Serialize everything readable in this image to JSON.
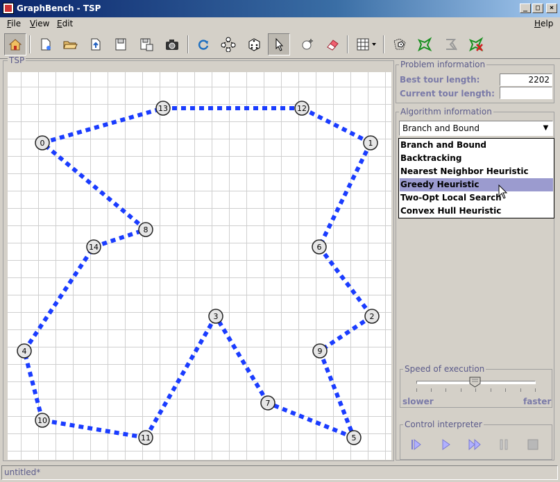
{
  "window": {
    "title": "GraphBench - TSP",
    "btn_min": "_",
    "btn_max": "□",
    "btn_close": "×"
  },
  "menu": {
    "file": {
      "mn": "F",
      "rest": "ile"
    },
    "view": {
      "mn": "V",
      "rest": "iew"
    },
    "edit": {
      "mn": "E",
      "rest": "dit"
    },
    "help": {
      "mn": "H",
      "rest": "elp"
    }
  },
  "toolbar": {
    "icons": [
      "home-icon",
      "new-graph-icon",
      "open-folder-icon",
      "import-icon",
      "save-icon",
      "save-as-icon",
      "camera-icon",
      "refresh-icon",
      "layout-icon",
      "random-dice-icon",
      "select-pointer-icon",
      "add-node-icon",
      "eraser-icon",
      "grid-icon",
      "random-graph-icon",
      "tour-icon",
      "clear-tour-icon",
      "delete-tour-icon"
    ],
    "pressed": "select-pointer-icon"
  },
  "tsp_panel": {
    "title": "TSP"
  },
  "graph": {
    "nodes": [
      {
        "id": "0"
      },
      {
        "id": "1"
      },
      {
        "id": "2"
      },
      {
        "id": "3"
      },
      {
        "id": "4"
      },
      {
        "id": "5"
      },
      {
        "id": "6"
      },
      {
        "id": "7"
      },
      {
        "id": "8"
      },
      {
        "id": "9"
      },
      {
        "id": "10"
      },
      {
        "id": "11"
      },
      {
        "id": "12"
      },
      {
        "id": "13"
      },
      {
        "id": "14"
      }
    ],
    "tour": [
      "0",
      "13",
      "12",
      "1",
      "6",
      "2",
      "9",
      "5",
      "7",
      "3",
      "11",
      "10",
      "4",
      "14",
      "8",
      "0"
    ],
    "edge_color": "#1a3cff"
  },
  "problem": {
    "title": "Problem information",
    "best_label": "Best tour length:",
    "best_value": "2202",
    "current_label": "Current tour length:",
    "current_value": ""
  },
  "algorithm": {
    "title": "Algorithm information",
    "selected": "Branch and Bound",
    "options": [
      "Branch and Bound",
      "Backtracking",
      "Nearest Neighbor Heuristic",
      "Greedy Heuristic",
      "Two-Opt Local Search",
      "Convex Hull Heuristic"
    ],
    "highlighted": "Greedy Heuristic"
  },
  "speed": {
    "title": "Speed of execution",
    "slower": "slower",
    "faster": "faster",
    "level": 0.5
  },
  "control": {
    "title": "Control interpreter",
    "buttons": [
      "step-icon",
      "play-icon",
      "fast-forward-icon",
      "pause-icon",
      "stop-icon"
    ]
  },
  "status": {
    "text": "untitled*"
  }
}
